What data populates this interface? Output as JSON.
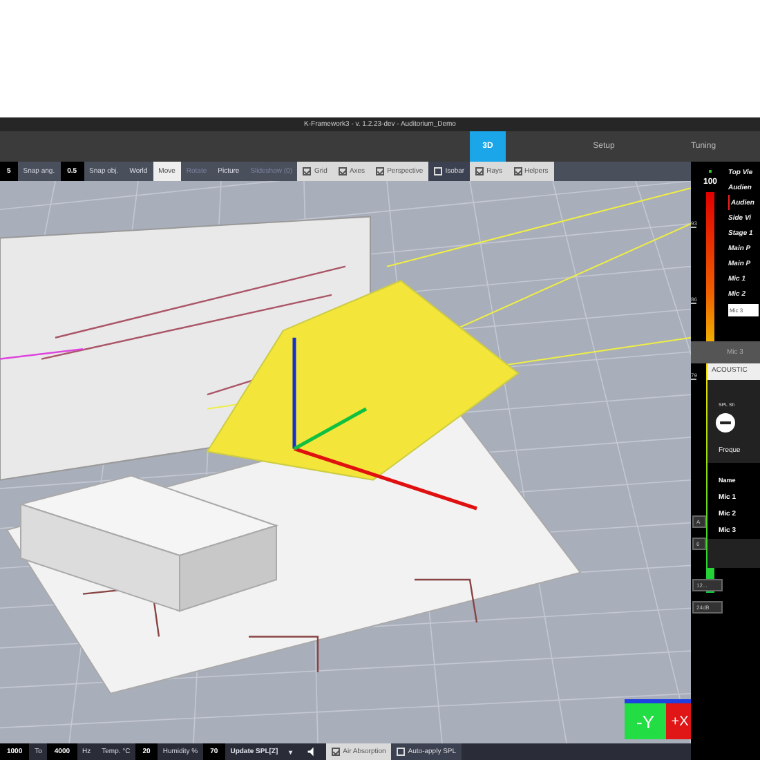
{
  "window": {
    "title": "K-Framework3 - v. 1.2.23-dev - Auditorium_Demo"
  },
  "tabs": [
    {
      "label": "3D",
      "selected": true
    },
    {
      "label": "Setup",
      "selected": false
    },
    {
      "label": "Tuning",
      "selected": false
    }
  ],
  "toolbar": [
    {
      "kind": "field",
      "value": "5"
    },
    {
      "kind": "label",
      "label": "Snap ang."
    },
    {
      "kind": "field",
      "value": "0.5"
    },
    {
      "kind": "label",
      "label": "Snap obj."
    },
    {
      "kind": "button",
      "label": "World",
      "disabled": false,
      "on": false
    },
    {
      "kind": "button",
      "label": "Move",
      "disabled": false,
      "on": true
    },
    {
      "kind": "button",
      "label": "Rotate",
      "disabled": true,
      "on": false
    },
    {
      "kind": "button",
      "label": "Picture",
      "disabled": false,
      "on": false
    },
    {
      "kind": "button",
      "label": "Slideshow (0)",
      "disabled": true,
      "on": false
    },
    {
      "kind": "check",
      "label": "Grid",
      "checked": true
    },
    {
      "kind": "check",
      "label": "Axes",
      "checked": true
    },
    {
      "kind": "check",
      "label": "Perspective",
      "checked": true
    },
    {
      "kind": "check",
      "label": "Isobar",
      "checked": false
    },
    {
      "kind": "check",
      "label": "Rays",
      "checked": true
    },
    {
      "kind": "check",
      "label": "Helpers",
      "checked": true
    }
  ],
  "color_scale": {
    "max": "100",
    "ticks": [
      "93",
      "86",
      "79"
    ]
  },
  "views": [
    {
      "label": "Top Vie",
      "selected": false
    },
    {
      "label": "Audien",
      "selected": false
    },
    {
      "label": "Audien",
      "selected": true
    },
    {
      "label": "Side Vi",
      "selected": false
    },
    {
      "label": "Stage 1",
      "selected": false
    },
    {
      "label": "Main P",
      "selected": false
    },
    {
      "label": "Main P",
      "selected": false
    },
    {
      "label": "Mic 1",
      "selected": false
    },
    {
      "label": "Mic 2",
      "selected": false
    }
  ],
  "view_name": {
    "value": "Mic 3"
  },
  "view_button": "Mic 3",
  "acoustics": {
    "title": "ACOUSTIC",
    "spl_label": "SPL Sh",
    "frequency_label": "Freque",
    "name_header": "Name",
    "mics": [
      "Mic 1",
      "Mic 2",
      "Mic 3"
    ]
  },
  "side_buttons": [
    "A",
    "6",
    "12...",
    "24dB"
  ],
  "bottom_bar": [
    {
      "kind": "field",
      "value": "1000"
    },
    {
      "kind": "label",
      "label": "To"
    },
    {
      "kind": "field",
      "value": "4000"
    },
    {
      "kind": "label",
      "label": "Hz"
    },
    {
      "kind": "label",
      "label": "Temp. °C"
    },
    {
      "kind": "field",
      "value": "20"
    },
    {
      "kind": "label",
      "label": "Humidity %"
    },
    {
      "kind": "field",
      "value": "70"
    },
    {
      "kind": "button",
      "label": "Update SPL[Z]"
    },
    {
      "kind": "button",
      "label": "▾"
    },
    {
      "kind": "icon"
    },
    {
      "kind": "check",
      "label": "Air Absorption",
      "checked": true
    },
    {
      "kind": "check",
      "label": "Auto-apply SPL",
      "checked": false
    }
  ],
  "view_cube": {
    "front": "-Y",
    "side": "+X"
  }
}
